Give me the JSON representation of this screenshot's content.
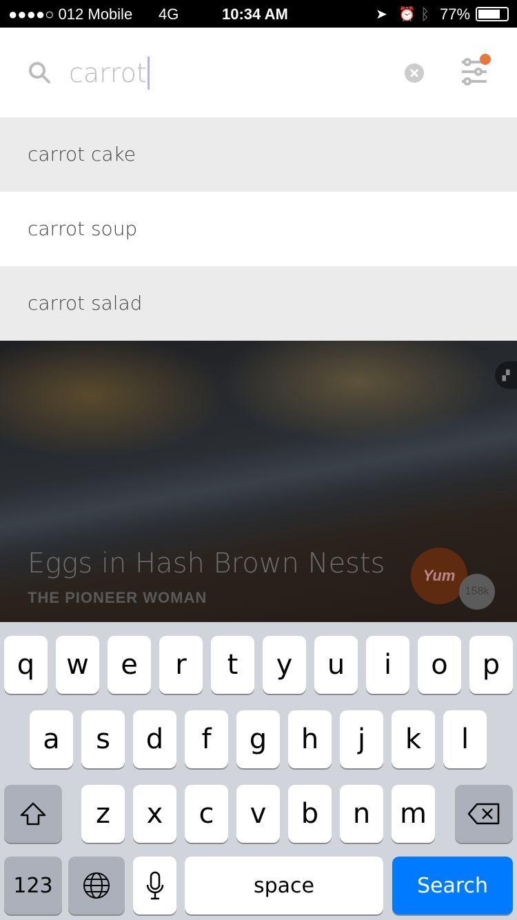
{
  "status": {
    "carrier": "●●●●○ 012 Mobile",
    "network": "4G",
    "time": "10:34 AM",
    "battery": "77%"
  },
  "search": {
    "value": "carrot",
    "icons": [
      "search-icon",
      "clear-icon",
      "filter-icon"
    ],
    "filter_badge_color": "#e8773a"
  },
  "suggestions": [
    {
      "label": "carrot cake"
    },
    {
      "label": "carrot soup"
    },
    {
      "label": "carrot salad"
    }
  ],
  "recipe": {
    "title": "Eggs in Hash Brown Nests",
    "source": "THE PIONEER WOMAN",
    "yum_label": "Yum",
    "yum_count": "158k",
    "yum_color": "#e8773a"
  },
  "keyboard": {
    "row1": [
      "q",
      "w",
      "e",
      "r",
      "t",
      "y",
      "u",
      "i",
      "o",
      "p"
    ],
    "row2": [
      "a",
      "s",
      "d",
      "f",
      "g",
      "h",
      "j",
      "k",
      "l"
    ],
    "row3": [
      "z",
      "x",
      "c",
      "v",
      "b",
      "n",
      "m"
    ],
    "numbers": "123",
    "space": "space",
    "search": "Search",
    "search_color": "#007aff"
  }
}
